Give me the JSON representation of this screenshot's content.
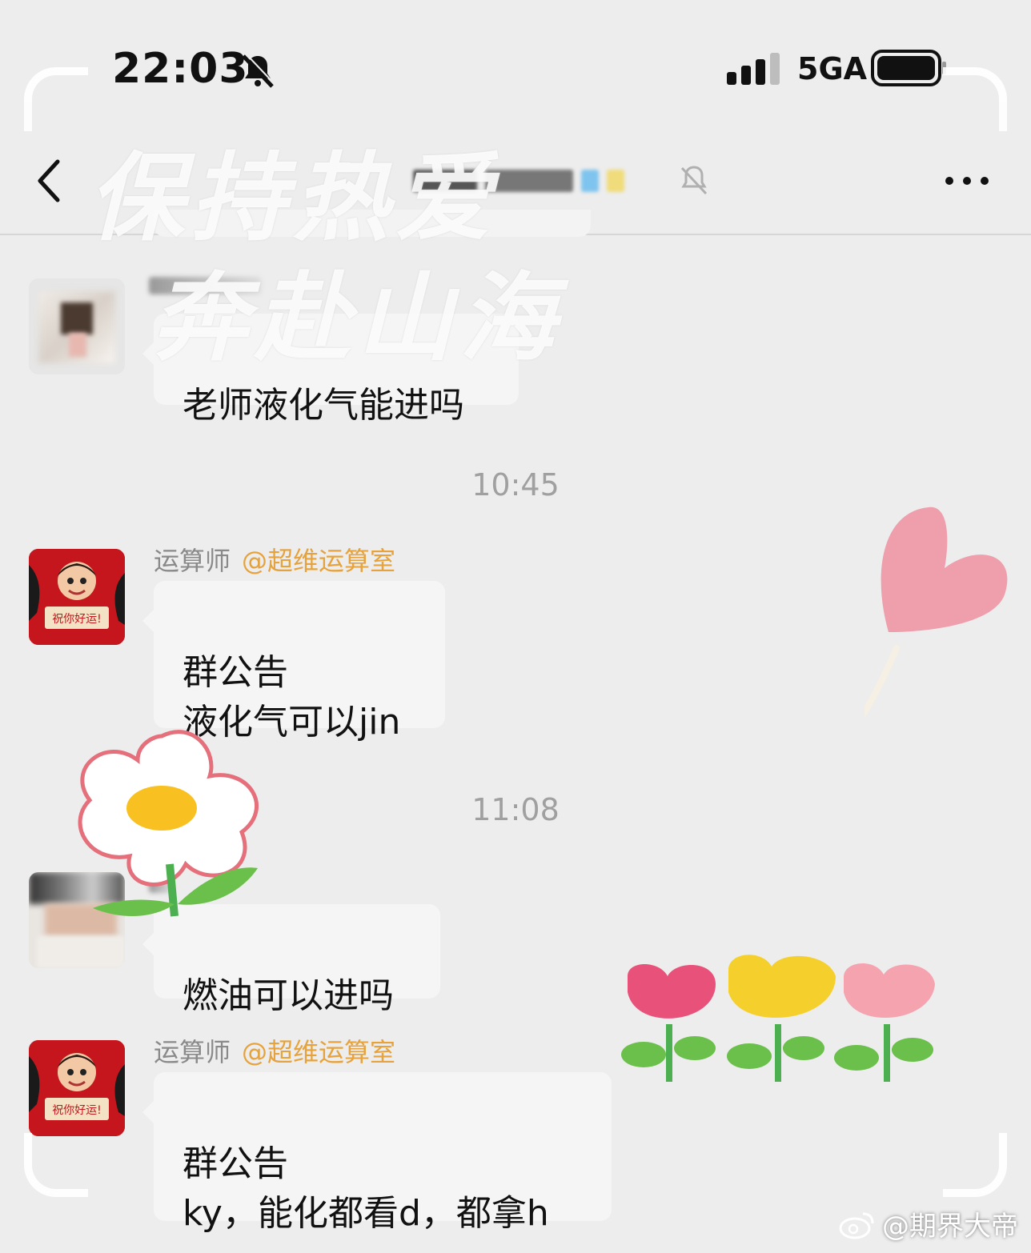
{
  "status_bar": {
    "time": "22:03",
    "network": "5GA"
  },
  "header": {
    "group_name": ""
  },
  "watermark": {
    "line1": "保持热爱",
    "line2": "奔赴山海"
  },
  "messages": [
    {
      "sender": "",
      "org": "",
      "text": "老师液化气能进吗"
    },
    {
      "timestamp": "10:45"
    },
    {
      "sender": "运算师",
      "org": "@超维运算室",
      "text": "群公告\n液化气可以jin"
    },
    {
      "timestamp": "11:08"
    },
    {
      "sender": "",
      "org": "",
      "text": "燃油可以进吗"
    },
    {
      "sender": "运算师",
      "org": "@超维运算室",
      "text": "群公告\nky，能化都看d，都拿h"
    }
  ],
  "avatar_card_text": "祝你好运!",
  "weibo_watermark": "@期界大帝",
  "colors": {
    "background": "#ededed",
    "bubble": "#f5f5f5",
    "org_tag": "#e6a23c"
  }
}
